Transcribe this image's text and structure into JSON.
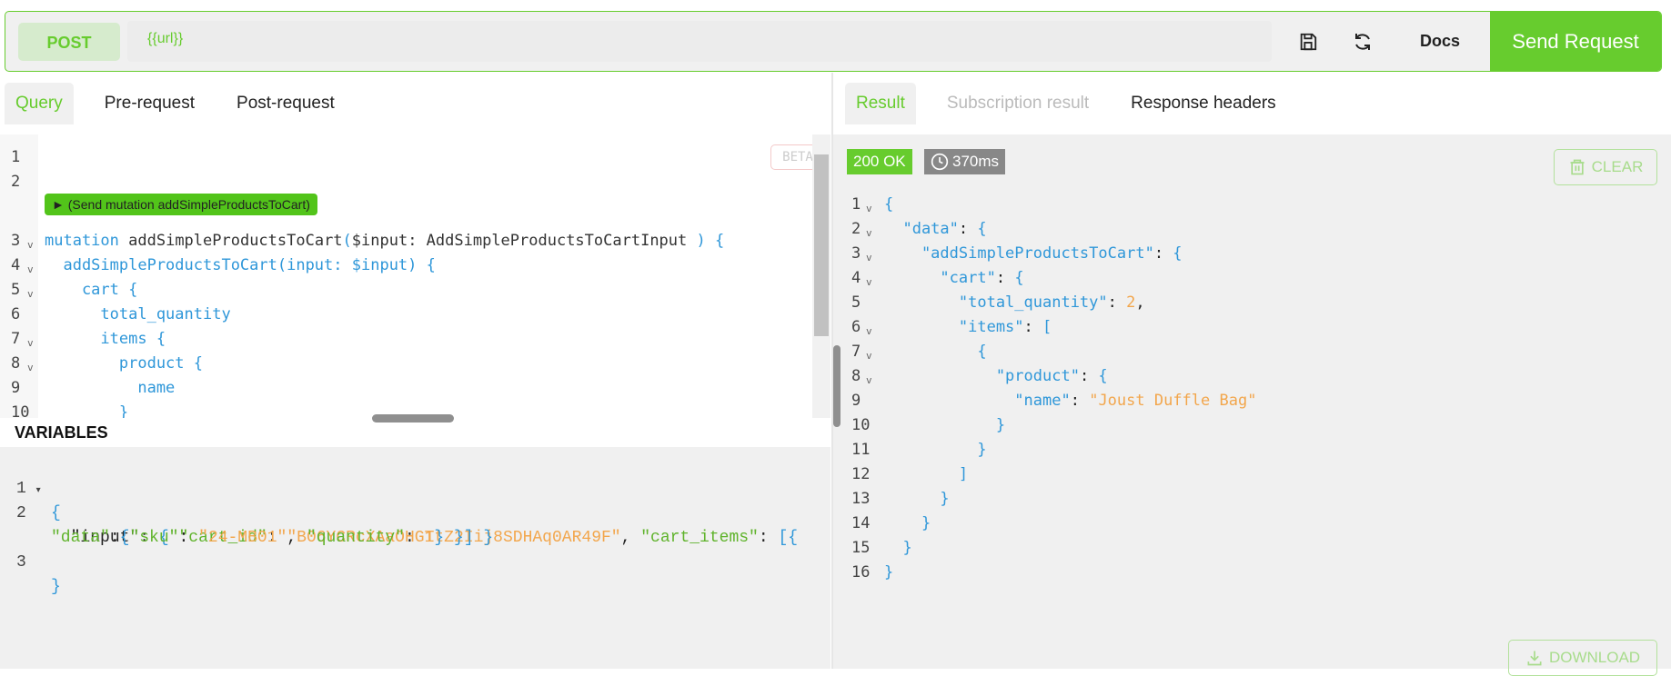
{
  "request": {
    "method": "POST",
    "url": "{{url}}",
    "docs_label": "Docs",
    "send_label": "Send Request"
  },
  "left_tabs": [
    {
      "label": "Query",
      "active": true
    },
    {
      "label": "Pre-request",
      "active": false
    },
    {
      "label": "Post-request",
      "active": false
    }
  ],
  "right_tabs": [
    {
      "label": "Result",
      "active": true
    },
    {
      "label": "Subscription result",
      "disabled": true
    },
    {
      "label": "Response headers",
      "active": false
    }
  ],
  "editor": {
    "beta_label": "BETA",
    "codelens": "► (Send mutation addSimpleProductsToCart)",
    "lines": [
      {
        "n": "1",
        "text": ""
      },
      {
        "n": "2",
        "text": ""
      },
      {
        "n": "3",
        "text": "mutation addSimpleProductsToCart($input: AddSimpleProductsToCartInput ) {",
        "fold": true
      },
      {
        "n": "4",
        "text": "  addSimpleProductsToCart(input: $input) {",
        "fold": true
      },
      {
        "n": "5",
        "text": "    cart {",
        "fold": true
      },
      {
        "n": "6",
        "text": "      total_quantity"
      },
      {
        "n": "7",
        "text": "      items {",
        "fold": true
      },
      {
        "n": "8",
        "text": "        product {",
        "fold": true
      },
      {
        "n": "9",
        "text": "          name"
      },
      {
        "n": "10",
        "text": "        }"
      }
    ]
  },
  "variables": {
    "title": "VARIABLES",
    "cart_id": "B06YCRcXAaOHGTtZ2Iij8SDHAq0AR49F",
    "sku": "24-MB01",
    "quantity": "1"
  },
  "response": {
    "status": "200 OK",
    "time": "370ms",
    "clear_label": "CLEAR",
    "download_label": "DOWNLOAD",
    "lines": [
      {
        "n": "1",
        "text": "{",
        "fold": true
      },
      {
        "n": "2",
        "text": "  \"data\": {",
        "fold": true
      },
      {
        "n": "3",
        "text": "    \"addSimpleProductsToCart\": {",
        "fold": true
      },
      {
        "n": "4",
        "text": "      \"cart\": {",
        "fold": true
      },
      {
        "n": "5",
        "text": "        \"total_quantity\": 2,"
      },
      {
        "n": "6",
        "text": "        \"items\": [",
        "fold": true
      },
      {
        "n": "7",
        "text": "          {",
        "fold": true
      },
      {
        "n": "8",
        "text": "            \"product\": {",
        "fold": true
      },
      {
        "n": "9",
        "text": "              \"name\": \"Joust Duffle Bag\""
      },
      {
        "n": "10",
        "text": "            }"
      },
      {
        "n": "11",
        "text": "          }"
      },
      {
        "n": "12",
        "text": "        ]"
      },
      {
        "n": "13",
        "text": "      }"
      },
      {
        "n": "14",
        "text": "    }"
      },
      {
        "n": "15",
        "text": "  }"
      },
      {
        "n": "16",
        "text": "}"
      }
    ]
  },
  "colors": {
    "accent": "#67cc2e",
    "string": "#f2a64c",
    "keyword": "#2f97d9"
  }
}
